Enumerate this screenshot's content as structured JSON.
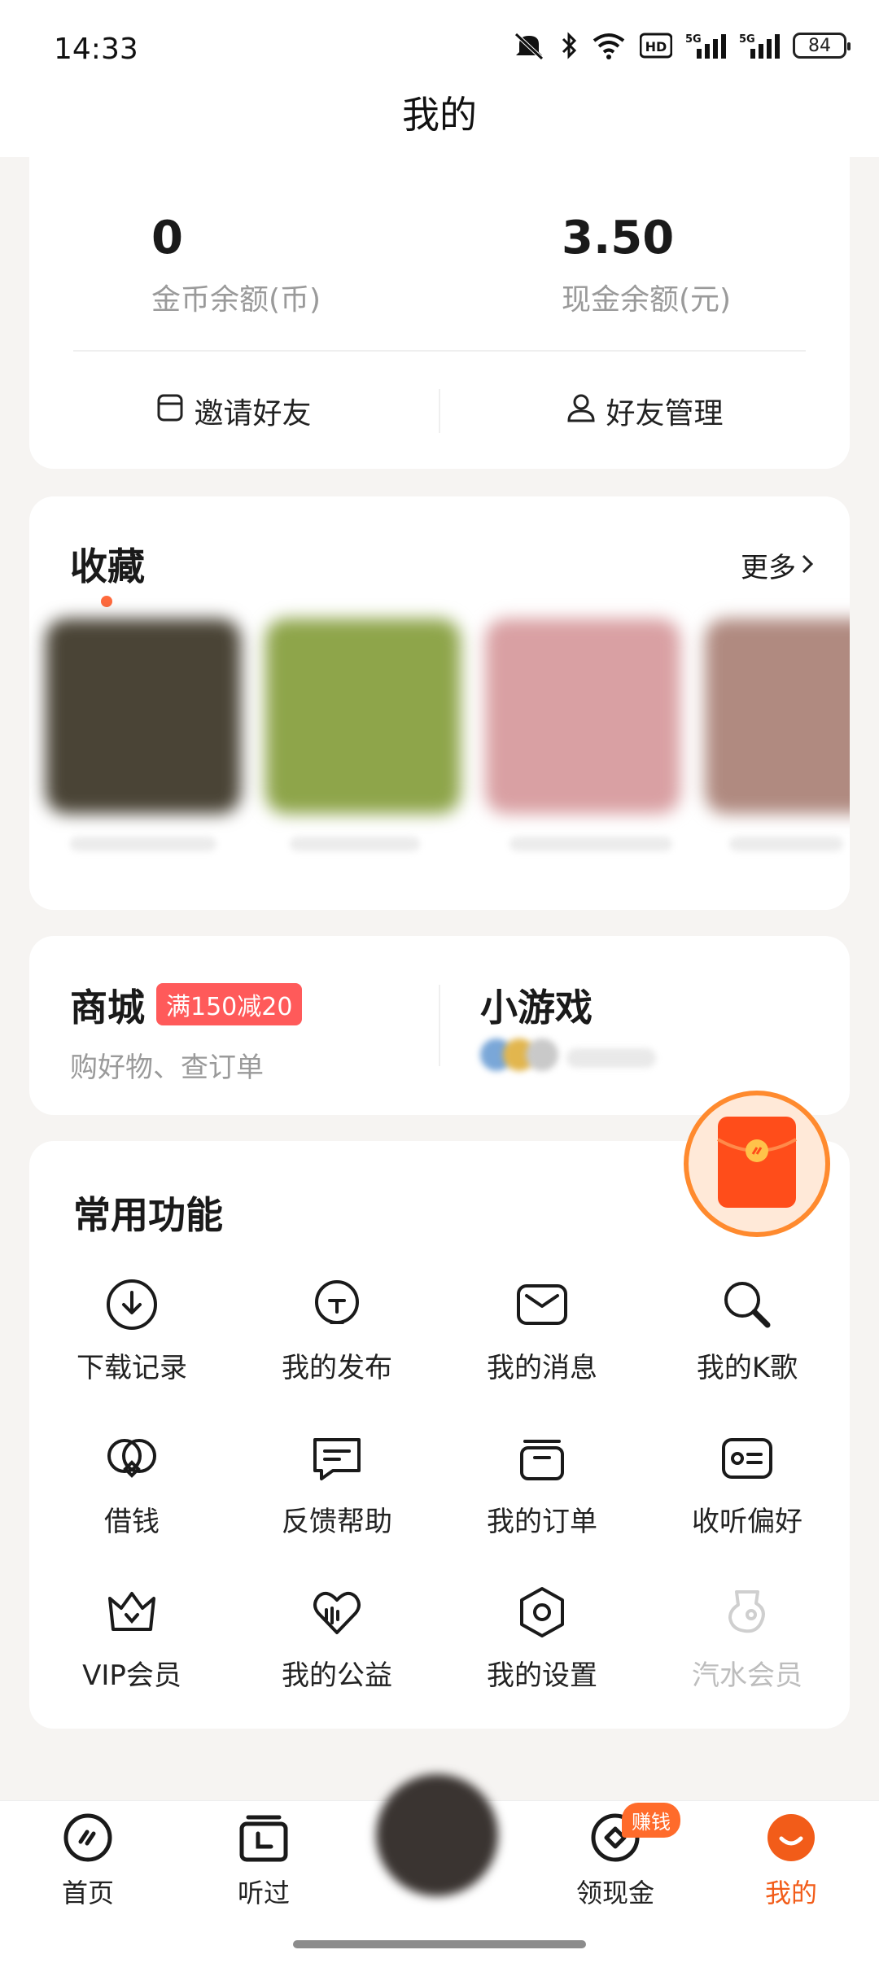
{
  "status_bar": {
    "time": "14:33",
    "network_1": "5G",
    "network_2": "5G",
    "battery": "84"
  },
  "header": {
    "title": "我的"
  },
  "assets": {
    "coins": {
      "value": "0",
      "label": "金币余额(币)"
    },
    "cash": {
      "value": "3.50",
      "label": "现金余额(元)"
    },
    "invite_label": "邀请好友",
    "friends_label": "好友管理"
  },
  "favorites": {
    "title": "收藏",
    "more_label": "更多",
    "thumb_colors": [
      "#4a4436",
      "#8ea54a",
      "#d9a0a3",
      "#b08a80"
    ]
  },
  "mall": {
    "title": "商城",
    "promo": "满150减20",
    "subtitle": "购好物、查订单",
    "games_title": "小游戏"
  },
  "functions": {
    "title": "常用功能",
    "items": [
      {
        "label": "下载记录",
        "icon": "download-icon"
      },
      {
        "label": "我的发布",
        "icon": "publish-icon"
      },
      {
        "label": "我的消息",
        "icon": "message-icon"
      },
      {
        "label": "我的K歌",
        "icon": "karaoke-icon"
      },
      {
        "label": "借钱",
        "icon": "loan-icon"
      },
      {
        "label": "反馈帮助",
        "icon": "feedback-icon"
      },
      {
        "label": "我的订单",
        "icon": "order-icon"
      },
      {
        "label": "收听偏好",
        "icon": "preference-icon"
      },
      {
        "label": "VIP会员",
        "icon": "crown-icon"
      },
      {
        "label": "我的公益",
        "icon": "charity-icon"
      },
      {
        "label": "我的设置",
        "icon": "settings-icon"
      },
      {
        "label": "汽水会员",
        "icon": "soda-member-icon"
      }
    ]
  },
  "bottom_nav": {
    "home": "首页",
    "listened": "听过",
    "cash": "领现金",
    "cash_badge": "赚钱",
    "me": "我的"
  },
  "colors": {
    "accent": "#f25c19",
    "promo": "#ff5a5a",
    "envelope": "#ff4d1a"
  }
}
